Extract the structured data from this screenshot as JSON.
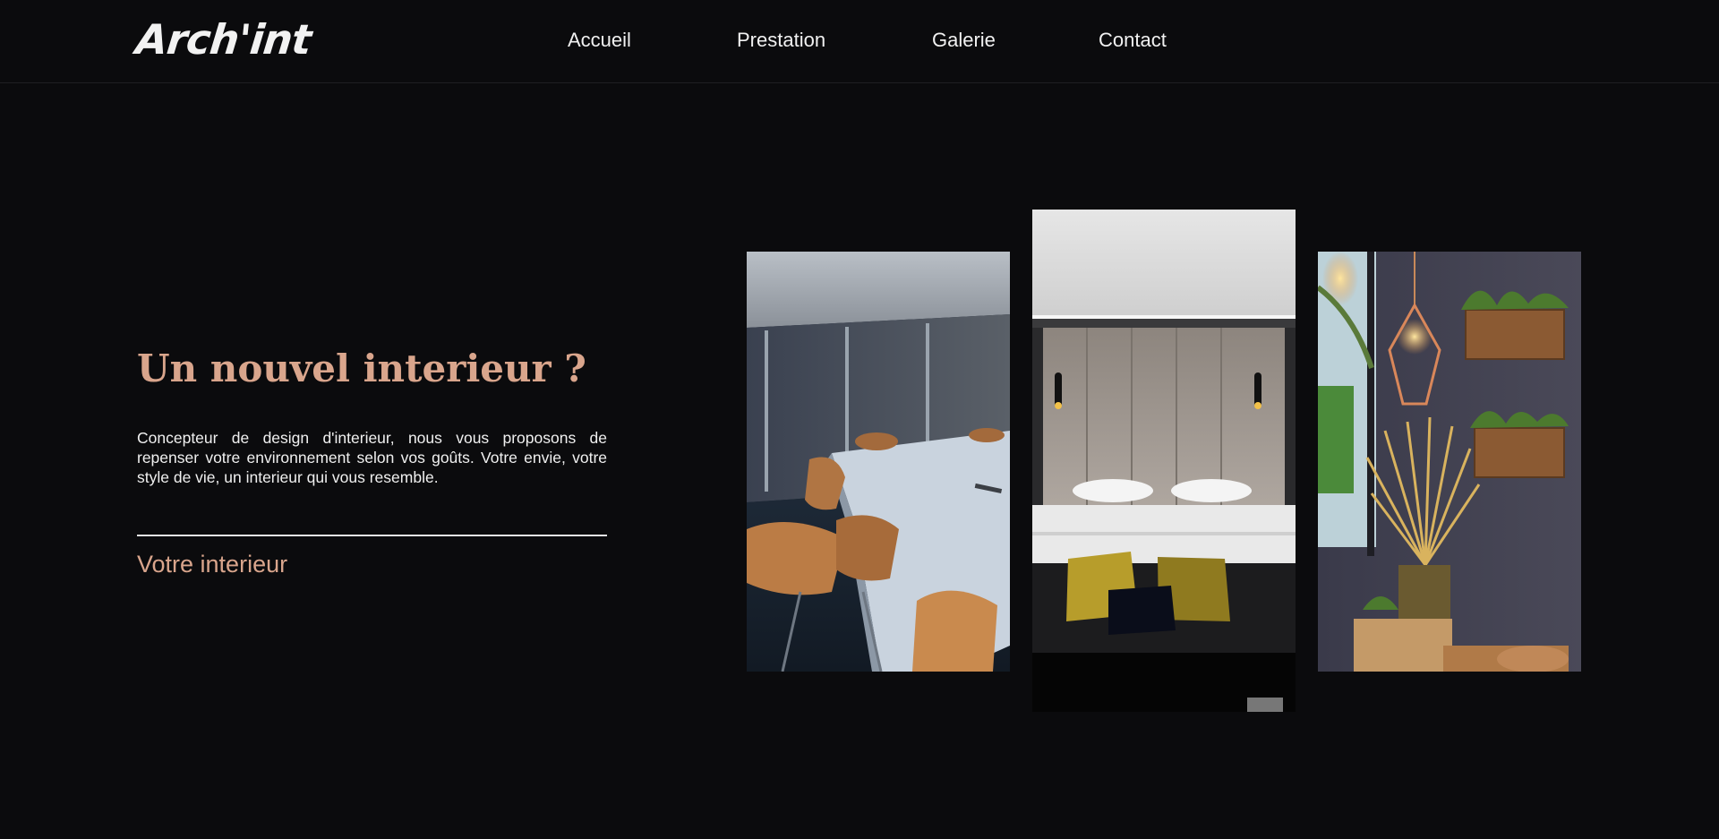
{
  "header": {
    "logo": "Arch'int",
    "nav": [
      "Accueil",
      "Prestation",
      "Galerie",
      "Contact"
    ]
  },
  "hero": {
    "title": "Un nouvel interieur ?",
    "description": "Concepteur de design d'interieur, nous vous proposons de repenser votre environnement selon vos goûts. Votre envie, votre style de vie, un interieur qui vous resemble.",
    "link": "Votre interieur"
  },
  "colors": {
    "background": "#0b0b0d",
    "accent": "#d9a58c",
    "text": "#ececec"
  }
}
